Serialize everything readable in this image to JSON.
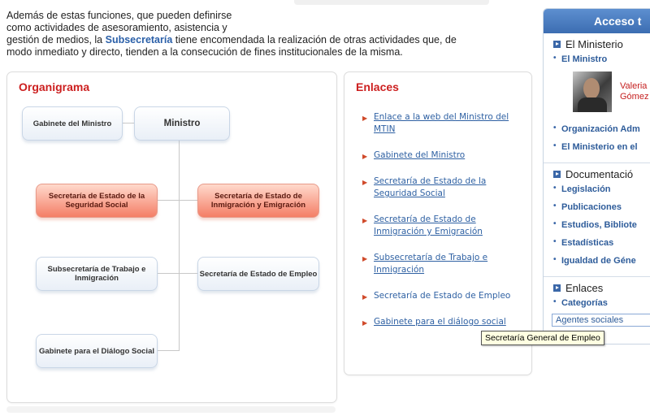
{
  "intro": {
    "line1": "Además de estas funciones, que pueden definirse",
    "line2": "como actividades de asesoramiento, asistencia y",
    "line3_before": "gestión de medios, la ",
    "line3_bold": "Subsecretaría",
    "line3_after": " tiene encomendada la realización de otras actividades que, de",
    "line4": "modo inmediato y directo, tienden a la consecución de fines institucionales de la misma."
  },
  "organigrama": {
    "title": "Organigrama",
    "boxes": {
      "gabinete_ministro": "Gabinete del Ministro",
      "ministro": "Ministro",
      "se_seguridad_social": "Secretaría de Estado de la Seguridad Social",
      "se_inmigracion": "Secretaría de Estado de Inmigración y Emigración",
      "subsecretaria": "Subsecretaría de Trabajo e Inmigración",
      "se_empleo": "Secretaría de Estado de Empleo",
      "gabinete_dialogo": "Gabinete para el Diálogo Social"
    }
  },
  "enlaces": {
    "title": "Enlaces",
    "items": [
      {
        "label": "Enlace a la web del Ministro del MTIN"
      },
      {
        "label": "Gabinete del Ministro"
      },
      {
        "label": "Secretaría de Estado de la Seguridad Social"
      },
      {
        "label": "Secretaría de Estado de Inmigración y Emigración"
      },
      {
        "label": "Subsecretaría de Trabajo e Inmigración"
      },
      {
        "label": "Secretaría de Estado de Empleo"
      },
      {
        "label": "Gabinete para el diálogo social"
      }
    ]
  },
  "tooltip": "Secretaría General de Empleo",
  "sidebar": {
    "header": "Acceso t",
    "sections": {
      "ministerio": {
        "title": "El Ministerio",
        "item_ministro": "El Ministro",
        "person_line1": "Valeria",
        "person_line2": "Gómez",
        "item_organizacion": "Organización Adm",
        "item_ministerio_en": "El Ministerio en el"
      },
      "documentacion": {
        "title": "Documentació",
        "items": [
          "Legislación",
          "Publicaciones",
          "Estudios, Bibliote",
          "Estadísticas",
          "Igualdad de Géne"
        ]
      },
      "enlaces": {
        "title": "Enlaces",
        "item_categorias": "Categorías",
        "select_value": "Agentes sociales"
      }
    }
  },
  "colors": {
    "accent_red": "#cc1f1f",
    "link_blue": "#2f61a3",
    "sidebar_blue": "#3c6db2"
  }
}
